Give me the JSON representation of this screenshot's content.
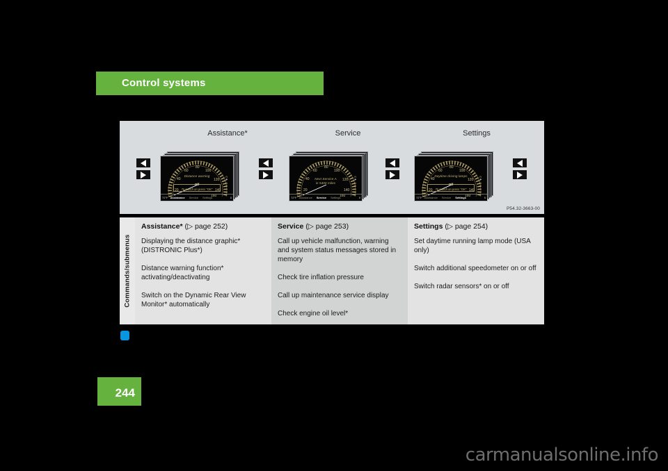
{
  "header": {
    "title": "Control systems"
  },
  "figure": {
    "code": "P54.32-3663-00",
    "columns": [
      {
        "label": "Assistance*"
      },
      {
        "label": "Service"
      },
      {
        "label": "Settings"
      }
    ],
    "clusters": [
      {
        "name": "assistance-cluster",
        "title": "Distance warning",
        "state": "Off",
        "hint": "To switch on press \"OK\"",
        "temp": "72°F",
        "gear": "5",
        "menu": [
          "Assistance",
          "Service",
          "Settings"
        ],
        "active_menu": "Assistance",
        "speed_ticks": [
          "20",
          "40",
          "60",
          "80",
          "100",
          "120",
          "140",
          "160"
        ]
      },
      {
        "name": "service-cluster",
        "title": "Next Service A",
        "state": "in 5400 miles",
        "hint": "",
        "temp": "72°F",
        "gear": "5",
        "menu": [
          "Assistance",
          "Service",
          "Settings"
        ],
        "active_menu": "Service",
        "speed_ticks": [
          "20",
          "40",
          "60",
          "80",
          "100",
          "120",
          "140",
          "160"
        ]
      },
      {
        "name": "settings-cluster",
        "title": "Daytime driving lamps",
        "state": "Off",
        "hint": "To switch on press \"OK\"",
        "temp": "72°F",
        "gear": "5",
        "menu": [
          "Assistance",
          "Service",
          "Settings"
        ],
        "active_menu": "Settings",
        "speed_ticks": [
          "20",
          "40",
          "60",
          "80",
          "100",
          "120",
          "140",
          "160"
        ]
      }
    ],
    "nav_buttons": {
      "left_label": "previous-menu",
      "right_label": "next-menu"
    }
  },
  "table": {
    "side_label": "Commands/submenus",
    "columns": [
      {
        "head_bold": "Assistance*",
        "head_ref": "(▷ page 252)",
        "cells": [
          "Displaying the distance graphic* (DISTRONIC Plus*)",
          "Distance warning function* activating/deactivating",
          "Switch on the Dynamic Rear View Monitor* automatically"
        ]
      },
      {
        "head_bold": "Service",
        "head_ref": "(▷ page 253)",
        "cells": [
          "Call up vehicle malfunction, warning and system status messages stored in memory",
          "Check tire inflation pressure",
          "Call up maintenance service display",
          "Check engine oil level*"
        ]
      },
      {
        "head_bold": "Settings",
        "head_ref": "(▷ page 254)",
        "cells": [
          "Set daytime running lamp mode (USA only)",
          "Switch additional speedometer on or off",
          "Switch radar sensors* on or off"
        ]
      }
    ]
  },
  "page": {
    "number": "244"
  },
  "watermark": {
    "text": "carmanualsonline.info"
  },
  "colors": {
    "brand_green": "#66B23E",
    "figure_bg": "#D9DCDE",
    "table_bg_light": "#E3E3E3",
    "table_bg_dark": "#D2D3D3",
    "accent_blue": "#0896E0",
    "cluster_gold": "#C9B77A"
  }
}
